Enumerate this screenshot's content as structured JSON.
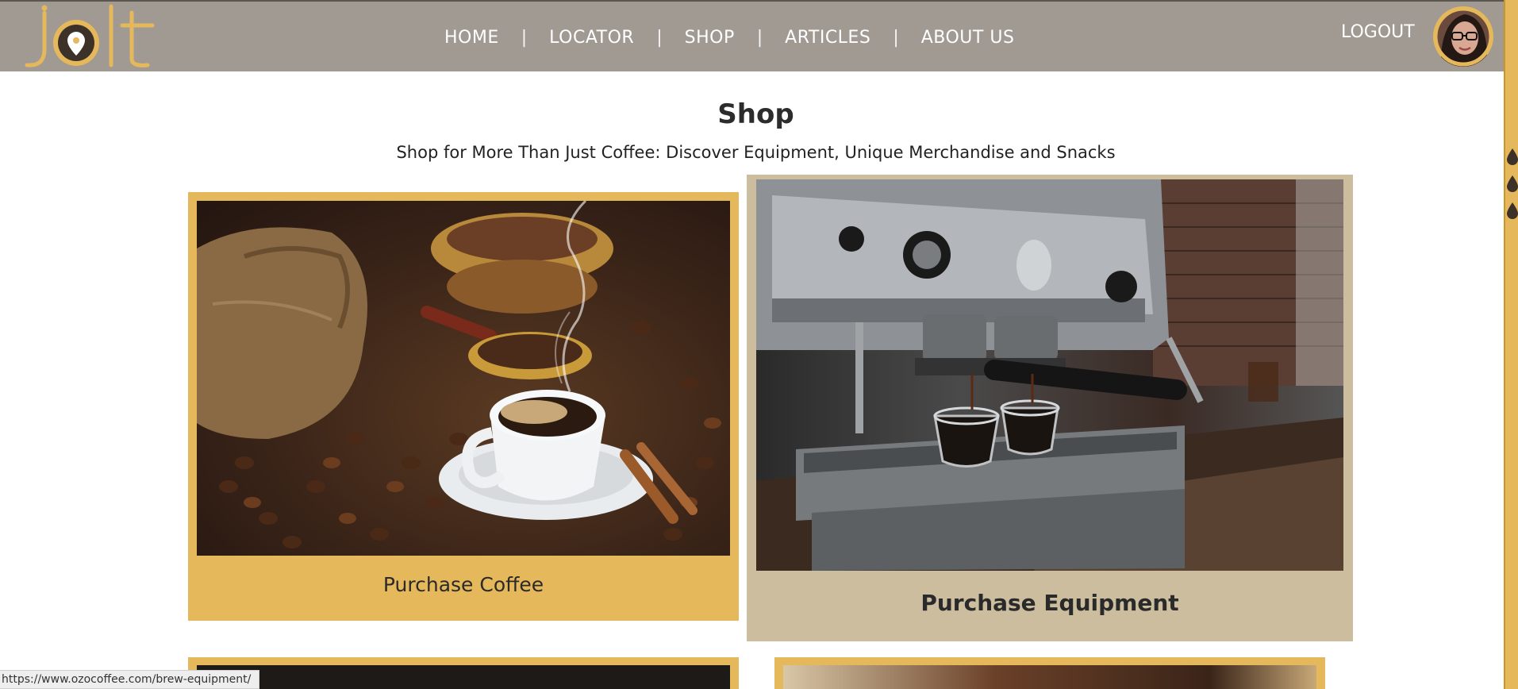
{
  "brand": {
    "logo_text": "jolt",
    "accent": "#e6b85c",
    "navbar_bg": "#a09a93",
    "dark": "#3d3229"
  },
  "nav": {
    "items": [
      {
        "label": "HOME"
      },
      {
        "label": "LOCATOR"
      },
      {
        "label": "SHOP"
      },
      {
        "label": "ARTICLES"
      },
      {
        "label": "ABOUT US"
      }
    ],
    "separator": "|",
    "logout_label": "LOGOUT"
  },
  "main": {
    "title": "Shop",
    "subtitle": "Shop for More Than Just Coffee: Discover Equipment, Unique Merchandise and Snacks",
    "cards": [
      {
        "label": "Purchase Coffee",
        "image": "coffee-cup-beans-photo"
      },
      {
        "label": "Purchase Equipment",
        "image": "espresso-machine-photo"
      }
    ]
  },
  "status_bar": {
    "url": "https://www.ozocoffee.com/brew-equipment/"
  }
}
